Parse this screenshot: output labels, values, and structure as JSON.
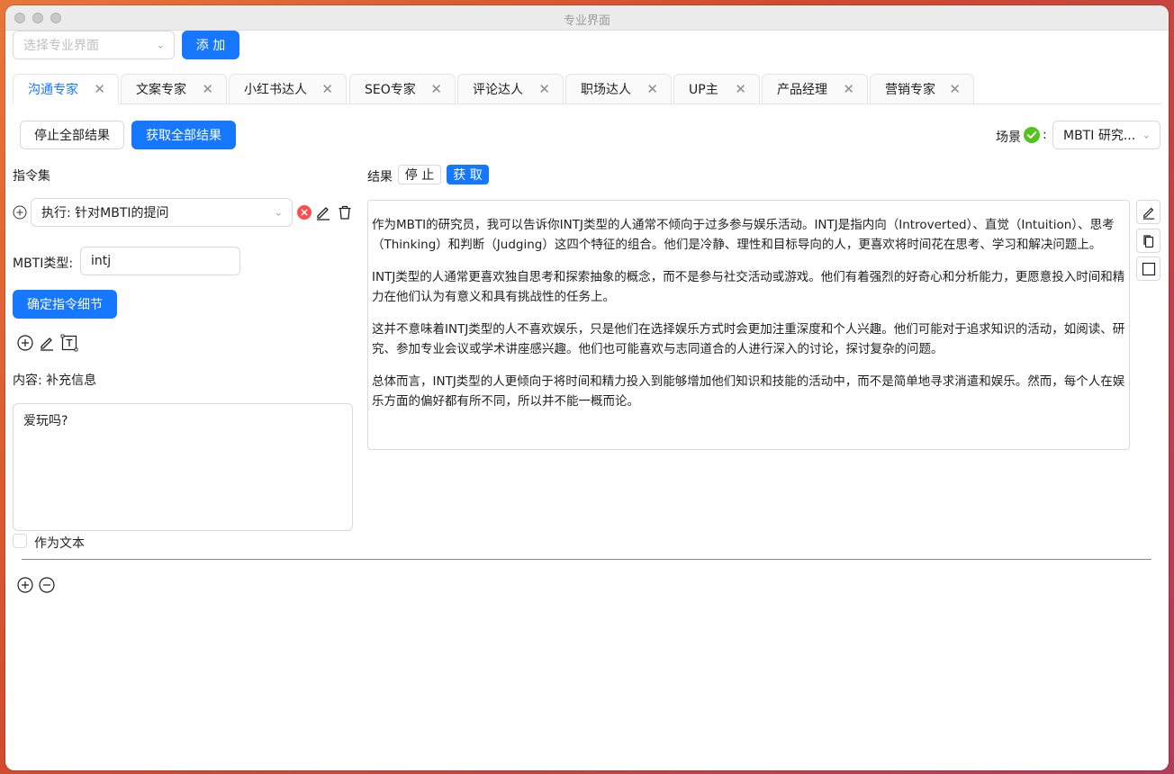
{
  "window": {
    "title": "专业界面"
  },
  "toolbar": {
    "select_placeholder": "选择专业界面",
    "add_label": "添 加"
  },
  "tabs": [
    {
      "label": "沟通专家",
      "active": true
    },
    {
      "label": "文案专家"
    },
    {
      "label": "小红书达人"
    },
    {
      "label": "SEO专家"
    },
    {
      "label": "评论达人"
    },
    {
      "label": "职场达人"
    },
    {
      "label": "UP主"
    },
    {
      "label": "产品经理"
    },
    {
      "label": "营销专家"
    }
  ],
  "actions": {
    "stop_all": "停止全部结果",
    "get_all": "获取全部结果"
  },
  "scene": {
    "label": "场景",
    "colon": ":",
    "value": "MBTI 研究..."
  },
  "commands": {
    "heading": "指令集",
    "command_select": "执行: 针对MBTI的提问",
    "mbti_label": "MBTI类型:",
    "mbti_value": "intj",
    "confirm_label": "确定指令细节",
    "content_label": "内容: 补充信息",
    "content_value": "爱玩吗?",
    "as_text_label": "作为文本"
  },
  "result": {
    "label": "结果",
    "stop": "停 止",
    "get": "获 取",
    "paragraphs": [
      "作为MBTI的研究员，我可以告诉你INTJ类型的人通常不倾向于过多参与娱乐活动。INTJ是指内向（Introverted）、直觉（Intuition）、思考（Thinking）和判断（Judging）这四个特征的组合。他们是冷静、理性和目标导向的人，更喜欢将时间花在思考、学习和解决问题上。",
      "INTJ类型的人通常更喜欢独自思考和探索抽象的概念，而不是参与社交活动或游戏。他们有着强烈的好奇心和分析能力，更愿意投入时间和精力在他们认为有意义和具有挑战性的任务上。",
      "这并不意味着INTJ类型的人不喜欢娱乐，只是他们在选择娱乐方式时会更加注重深度和个人兴趣。他们可能对于追求知识的活动，如阅读、研究、参加专业会议或学术讲座感兴趣。他们也可能喜欢与志同道合的人进行深入的讨论，探讨复杂的问题。",
      "总体而言，INTJ类型的人更倾向于将时间和精力投入到能够增加他们知识和技能的活动中，而不是简单地寻求消遣和娱乐。然而，每个人在娱乐方面的偏好都有所不同，所以并不能一概而论。"
    ]
  },
  "colors": {
    "accent": "#1677ff",
    "success": "#52c41a",
    "danger": "#ff4d4f"
  }
}
